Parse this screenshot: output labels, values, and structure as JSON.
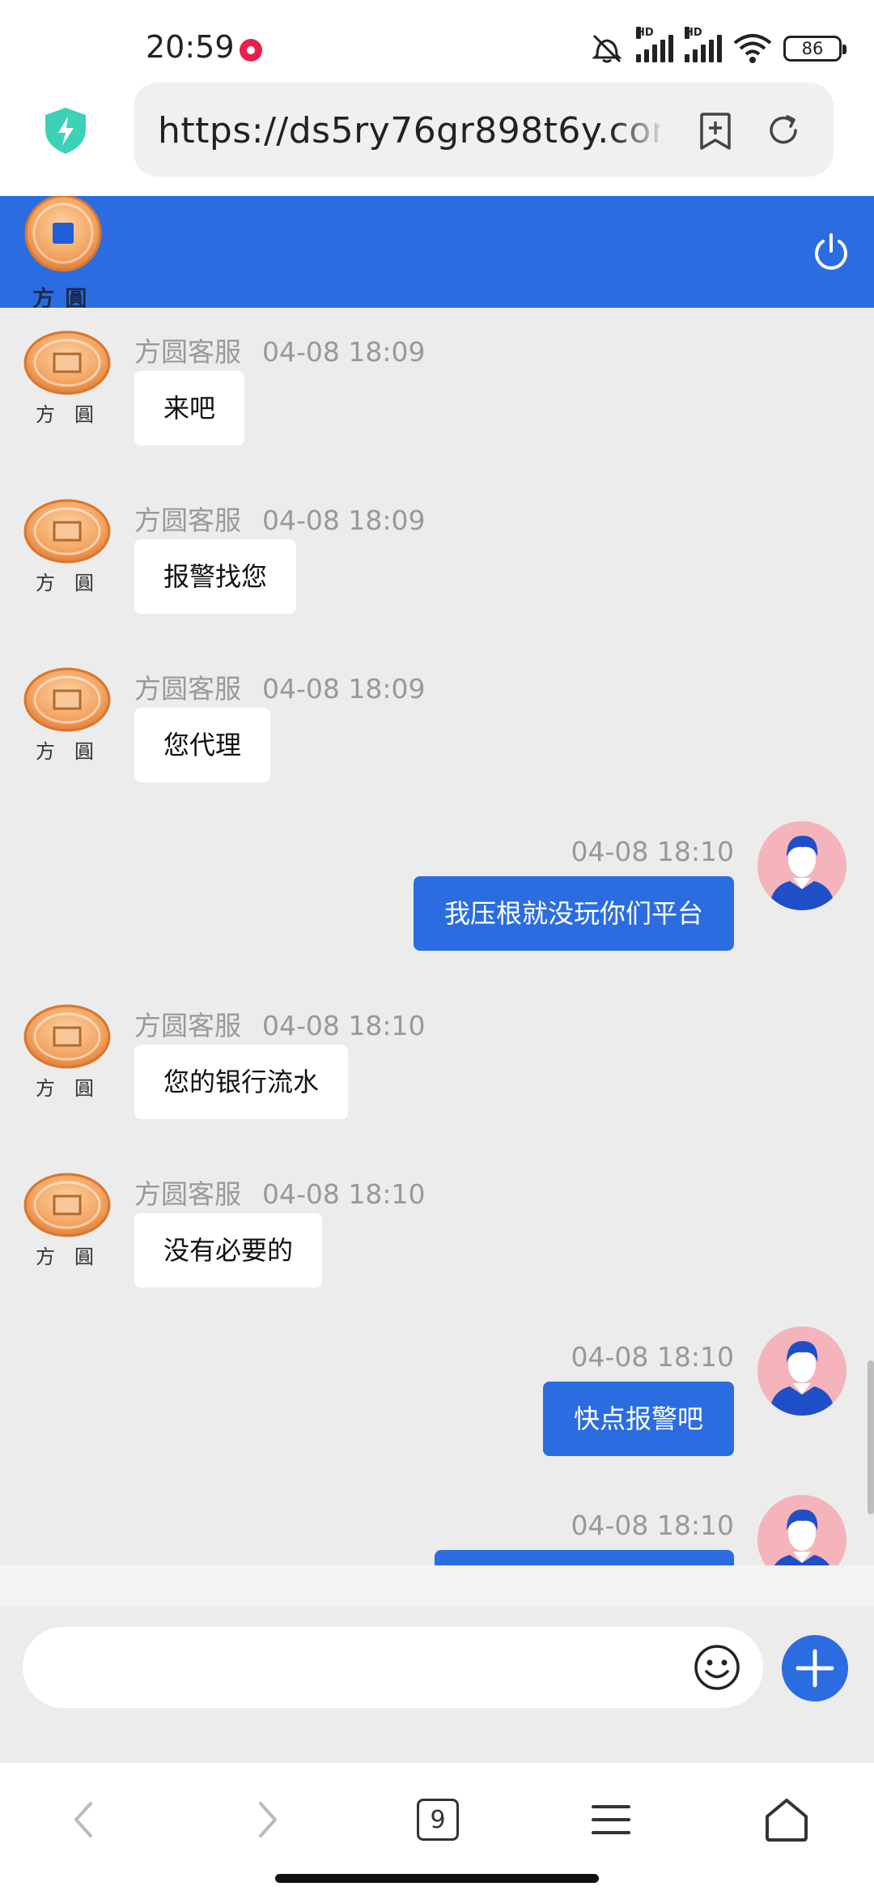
{
  "status_bar": {
    "time": "20:59",
    "battery": "86",
    "signal_1_label": "HD",
    "signal_2_label": "HD"
  },
  "browser": {
    "url": "https://ds5ry76gr898t6y.com",
    "tab_count": "9"
  },
  "header": {
    "logo_caption": "方 圓"
  },
  "messages": [
    {
      "side": "left",
      "sender": "方圆客服",
      "time": "04-08 18:09",
      "text": "来吧"
    },
    {
      "side": "left",
      "sender": "方圆客服",
      "time": "04-08 18:09",
      "text": "报警找您"
    },
    {
      "side": "left",
      "sender": "方圆客服",
      "time": "04-08 18:09",
      "text": "您代理"
    },
    {
      "side": "right",
      "time": "04-08 18:10",
      "text": "我压根就没玩你们平台"
    },
    {
      "side": "left",
      "sender": "方圆客服",
      "time": "04-08 18:10",
      "text": "您的银行流水"
    },
    {
      "side": "left",
      "sender": "方圆客服",
      "time": "04-08 18:10",
      "text": "没有必要的"
    },
    {
      "side": "right",
      "time": "04-08 18:10",
      "text": "快点报警吧"
    },
    {
      "side": "right",
      "time": "04-08 18:10",
      "text": ""
    }
  ],
  "colors": {
    "accent": "#2b6de0",
    "chat_bg": "#ececec",
    "meta_text": "#999999",
    "avatar_bg": "#f5b4bb",
    "coin": "#f0a05a"
  },
  "icons": {
    "shield": "shield-bolt-icon",
    "bookmark": "bookmark-add-icon",
    "reload": "reload-icon",
    "power": "power-icon",
    "emoji": "smiley-icon",
    "plus": "plus-icon",
    "back": "chevron-left-icon",
    "forward": "chevron-right-icon",
    "tabs": "tabs-icon",
    "menu": "menu-icon",
    "home": "home-icon"
  }
}
